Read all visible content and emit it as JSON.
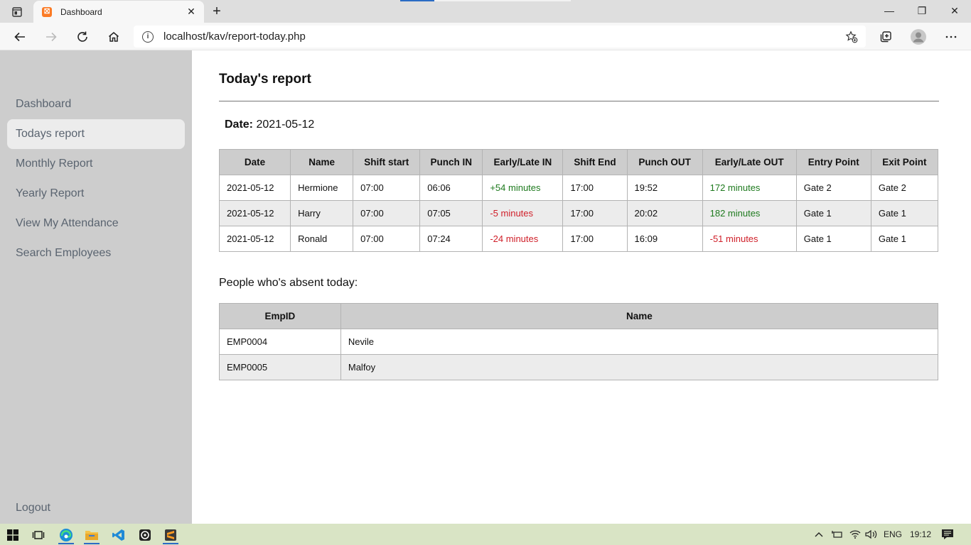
{
  "browser": {
    "tab_title": "Dashboard",
    "tab_favicon_glyph": "⛝",
    "url_prefix": "localhost",
    "url_path": "/kav/report-today.php",
    "new_tab_glyph": "+",
    "close_tab_glyph": "✕",
    "minimize_glyph": "—",
    "restore_glyph": "❐",
    "close_glyph": "✕"
  },
  "sidebar": {
    "items": [
      {
        "label": "Dashboard"
      },
      {
        "label": "Todays report"
      },
      {
        "label": "Monthly Report"
      },
      {
        "label": "Yearly Report"
      },
      {
        "label": "View My Attendance"
      },
      {
        "label": "Search Employees"
      }
    ],
    "active_index": 1,
    "logout_label": "Logout"
  },
  "page": {
    "title": "Today's report",
    "date_label": "Date:",
    "date_value": "2021-05-12"
  },
  "report": {
    "headers": [
      "Date",
      "Name",
      "Shift start",
      "Punch IN",
      "Early/Late IN",
      "Shift End",
      "Punch OUT",
      "Early/Late OUT",
      "Entry Point",
      "Exit Point"
    ],
    "rows": [
      [
        "2021-05-12",
        "Hermione",
        "07:00",
        "06:06",
        "+54 minutes",
        "17:00",
        "19:52",
        "172 minutes",
        "Gate 2",
        "Gate 2"
      ],
      [
        "2021-05-12",
        "Harry",
        "07:00",
        "07:05",
        "-5 minutes",
        "17:00",
        "20:02",
        "182 minutes",
        "Gate 1",
        "Gate 1"
      ],
      [
        "2021-05-12",
        "Ronald",
        "07:00",
        "07:24",
        "-24 minutes",
        "17:00",
        "16:09",
        "-51 minutes",
        "Gate 1",
        "Gate 1"
      ]
    ]
  },
  "absent": {
    "label": "People who's absent today:",
    "headers": [
      "EmpID",
      "Name"
    ],
    "rows": [
      [
        "EMP0004",
        "Nevile"
      ],
      [
        "EMP0005",
        "Malfoy"
      ]
    ]
  },
  "taskbar": {
    "language": "ENG",
    "time": "19:12"
  },
  "colors": {
    "positive": "#1e7a1e",
    "negative": "#d0202a",
    "sidebar_bg": "#cdcdcd",
    "active_item_bg": "#ececec"
  }
}
